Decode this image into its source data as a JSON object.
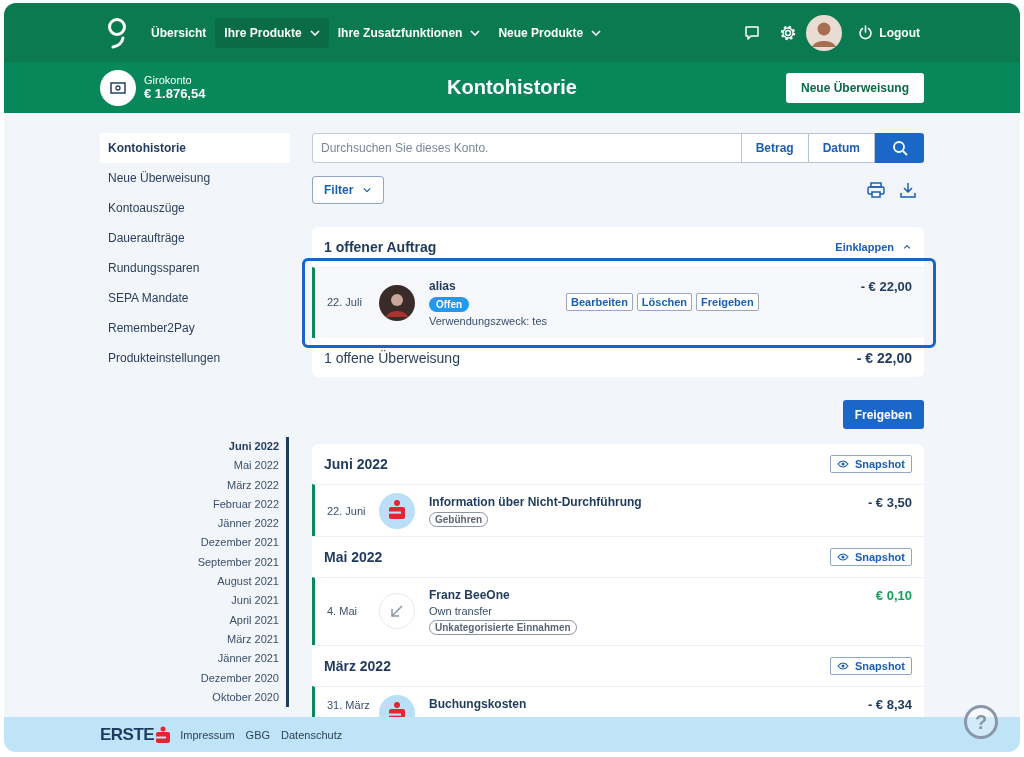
{
  "topbar": {
    "nav": [
      {
        "label": "Übersicht",
        "selected": false,
        "dropdown": false
      },
      {
        "label": "Ihre Produkte",
        "selected": true,
        "dropdown": true
      },
      {
        "label": "Ihre Zusatzfunktionen",
        "selected": false,
        "dropdown": true
      },
      {
        "label": "Neue Produkte",
        "selected": false,
        "dropdown": true
      }
    ],
    "logout": "Logout"
  },
  "account": {
    "name": "Girokonto",
    "balance": "€ 1.876,54",
    "title": "Kontohistorie",
    "button": "Neue Überweisung"
  },
  "sidebar": {
    "items": [
      {
        "label": "Kontohistorie",
        "selected": true
      },
      {
        "label": "Neue Überweisung",
        "selected": false
      },
      {
        "label": "Kontoauszüge",
        "selected": false
      },
      {
        "label": "Daueraufträge",
        "selected": false
      },
      {
        "label": "Rundungssparen",
        "selected": false
      },
      {
        "label": "SEPA Mandate",
        "selected": false
      },
      {
        "label": "Remember2Pay",
        "selected": false
      },
      {
        "label": "Produkteinstellungen",
        "selected": false
      }
    ]
  },
  "timeline": [
    {
      "label": "Juni 2022",
      "selected": true
    },
    {
      "label": "Mai 2022",
      "selected": false
    },
    {
      "label": "März 2022",
      "selected": false
    },
    {
      "label": "Februar 2022",
      "selected": false
    },
    {
      "label": "Jänner 2022",
      "selected": false
    },
    {
      "label": "Dezember 2021",
      "selected": false
    },
    {
      "label": "September 2021",
      "selected": false
    },
    {
      "label": "August 2021",
      "selected": false
    },
    {
      "label": "Juni 2021",
      "selected": false
    },
    {
      "label": "April 2021",
      "selected": false
    },
    {
      "label": "März 2021",
      "selected": false
    },
    {
      "label": "Jänner 2021",
      "selected": false
    },
    {
      "label": "Dezember 2020",
      "selected": false
    },
    {
      "label": "Oktober 2020",
      "selected": false
    }
  ],
  "search": {
    "placeholder": "Durchsuchen Sie dieses Konto.",
    "buttons": [
      "Betrag",
      "Datum"
    ],
    "filter": "Filter"
  },
  "pending": {
    "title": "1 offener Auftrag",
    "collapse": "Einklappen",
    "items": [
      {
        "date": "22. Juli",
        "name": "alias",
        "status": "Offen",
        "purpose": "Verwendungszweck: tes",
        "actions": [
          "Bearbeiten",
          "Löschen",
          "Freigeben"
        ],
        "amount": "- € 22,00",
        "highlighted": true
      }
    ],
    "summary": "1 offene Überweisung",
    "summary_amount": "- € 22,00"
  },
  "release_button": "Freigeben",
  "groups": [
    {
      "month": "Juni 2022",
      "snapshot": "Snapshot",
      "transactions": [
        {
          "kind": "bank",
          "date": "22. Juni",
          "title": "Information über Nicht-Durchführung",
          "tag": "Gebühren",
          "amount": "- € 3,50",
          "incoming": false
        }
      ]
    },
    {
      "month": "Mai 2022",
      "snapshot": "Snapshot",
      "transactions": [
        {
          "kind": "transfer",
          "date": "4. Mai",
          "title": "Franz BeeOne",
          "subtitle": "Own transfer",
          "tag": "Unkategorisierte Einnahmen",
          "amount": "€ 0,10",
          "incoming": true
        }
      ]
    },
    {
      "month": "März 2022",
      "snapshot": "Snapshot",
      "transactions": [
        {
          "kind": "bank",
          "date": "31. März",
          "title": "Buchungskosten",
          "amount": "- € 8,34",
          "incoming": false
        }
      ]
    }
  ],
  "footer": {
    "brand": "ERSTE",
    "links": [
      "Impressum",
      "GBG",
      "Datenschutz"
    ],
    "help": "?"
  }
}
